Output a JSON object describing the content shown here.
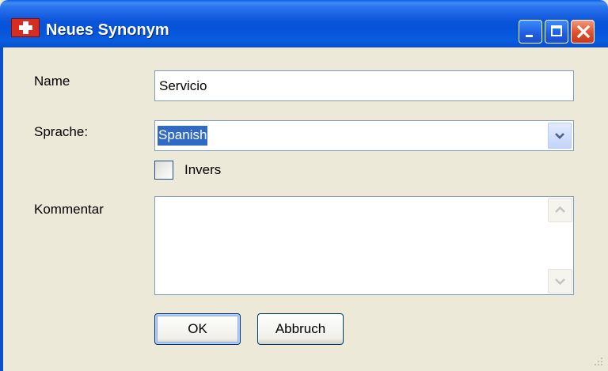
{
  "window": {
    "title": "Neues Synonym",
    "icon": "app-cross-icon",
    "controls": [
      "minimize-icon",
      "maximize-icon",
      "close-icon"
    ],
    "colors": {
      "titlebar": "#0A55DC",
      "face": "#ECE9D8",
      "close": "#E0502F",
      "selection": "#316AC5"
    }
  },
  "form": {
    "name_label": "Name",
    "name_value": "Servicio",
    "language_label": "Sprache:",
    "language_value": "Spanish",
    "invers_label": "Invers",
    "invers_checked": false,
    "comment_label": "Kommentar",
    "comment_value": ""
  },
  "buttons": {
    "ok_label": "OK",
    "cancel_label": "Abbruch"
  }
}
